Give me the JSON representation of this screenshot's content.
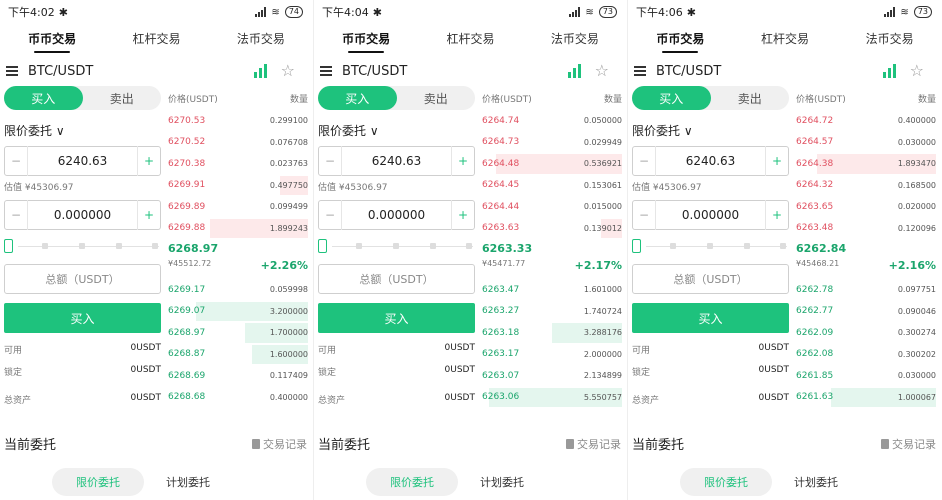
{
  "common": {
    "tabs": [
      "币币交易",
      "杠杆交易",
      "法币交易"
    ],
    "pair": "BTC/USDT",
    "buy_tab": "买入",
    "sell_tab": "卖出",
    "order_type": "限价委托",
    "price_header": "价格(USDT)",
    "qty_header": "数量",
    "minus": "−",
    "plus": "+",
    "amount_value": "0.000000",
    "total_placeholder": "总额（USDT）",
    "buy_button": "买入",
    "available_label": "可用",
    "available_value": "0USDT",
    "locked_label": "锁定",
    "locked_value": "0USDT",
    "assets_label": "总资产",
    "assets_value": "0USDT",
    "current_orders": "当前委托",
    "trade_records": "交易记录",
    "sub_tab_limit": "限价委托",
    "sub_tab_plan": "计划委托",
    "star": "☆",
    "chevron": "∨",
    "wifi": "≋",
    "bt": "✱"
  },
  "screens": [
    {
      "time": "下午4:02",
      "battery": "74",
      "price_value": "6240.63",
      "estimate": "估值 ¥45306.97",
      "asks": [
        {
          "price": "6270.53",
          "qty": "0.299100",
          "depth": 0.0
        },
        {
          "price": "6270.52",
          "qty": "0.076708",
          "depth": 0.0
        },
        {
          "price": "6270.38",
          "qty": "0.023763",
          "depth": 0.0
        },
        {
          "price": "6269.91",
          "qty": "0.497750",
          "depth": 0.2
        },
        {
          "price": "6269.89",
          "qty": "0.099499",
          "depth": 0.0
        },
        {
          "price": "6269.88",
          "qty": "1.899243",
          "depth": 0.7
        }
      ],
      "last_price": "6268.97",
      "last_cny": "¥45512.72",
      "change": "+2.26%",
      "bids": [
        {
          "price": "6269.17",
          "qty": "0.059998",
          "depth": 0.0
        },
        {
          "price": "6269.07",
          "qty": "3.200000",
          "depth": 0.8
        },
        {
          "price": "6268.97",
          "qty": "1.700000",
          "depth": 0.45
        },
        {
          "price": "6268.87",
          "qty": "1.600000",
          "depth": 0.4
        },
        {
          "price": "6268.69",
          "qty": "0.117409",
          "depth": 0.0
        },
        {
          "price": "6268.68",
          "qty": "0.400000",
          "depth": 0.0
        }
      ]
    },
    {
      "time": "下午4:04",
      "battery": "73",
      "price_value": "6240.63",
      "estimate": "",
      "asks": [
        {
          "price": "6264.74",
          "qty": "0.050000",
          "depth": 0.0
        },
        {
          "price": "6264.73",
          "qty": "0.029949",
          "depth": 0.0
        },
        {
          "price": "6264.48",
          "qty": "0.536921",
          "depth": 0.9
        },
        {
          "price": "6264.45",
          "qty": "0.153061",
          "depth": 0.0
        },
        {
          "price": "6264.44",
          "qty": "0.015000",
          "depth": 0.0
        },
        {
          "price": "6263.63",
          "qty": "0.139012",
          "depth": 0.15
        }
      ],
      "last_price": "6263.33",
      "last_cny": "¥45471.77",
      "change": "+2.17%",
      "bids": [
        {
          "price": "6263.47",
          "qty": "1.601000",
          "depth": 0.0
        },
        {
          "price": "6263.27",
          "qty": "1.740724",
          "depth": 0.0
        },
        {
          "price": "6263.18",
          "qty": "3.288176",
          "depth": 0.5
        },
        {
          "price": "6263.17",
          "qty": "2.000000",
          "depth": 0.0
        },
        {
          "price": "6263.07",
          "qty": "2.134899",
          "depth": 0.0
        },
        {
          "price": "6263.06",
          "qty": "5.550757",
          "depth": 0.95
        }
      ]
    },
    {
      "time": "下午4:06",
      "battery": "73",
      "price_value": "6240.63",
      "estimate": "估值 ¥45306.97",
      "asks": [
        {
          "price": "6264.72",
          "qty": "0.400000",
          "depth": 0.0
        },
        {
          "price": "6264.57",
          "qty": "0.030000",
          "depth": 0.0
        },
        {
          "price": "6264.38",
          "qty": "1.893470",
          "depth": 0.85
        },
        {
          "price": "6264.32",
          "qty": "0.168500",
          "depth": 0.0
        },
        {
          "price": "6263.65",
          "qty": "0.020000",
          "depth": 0.0
        },
        {
          "price": "6263.48",
          "qty": "0.120096",
          "depth": 0.0
        }
      ],
      "last_price": "6262.84",
      "last_cny": "¥45468.21",
      "change": "+2.16%",
      "bids": [
        {
          "price": "6262.78",
          "qty": "0.097751",
          "depth": 0.0
        },
        {
          "price": "6262.77",
          "qty": "0.090046",
          "depth": 0.0
        },
        {
          "price": "6262.09",
          "qty": "0.300274",
          "depth": 0.0
        },
        {
          "price": "6262.08",
          "qty": "0.300202",
          "depth": 0.0
        },
        {
          "price": "6261.85",
          "qty": "0.030000",
          "depth": 0.0
        },
        {
          "price": "6261.63",
          "qty": "1.000067",
          "depth": 0.75
        }
      ]
    }
  ]
}
